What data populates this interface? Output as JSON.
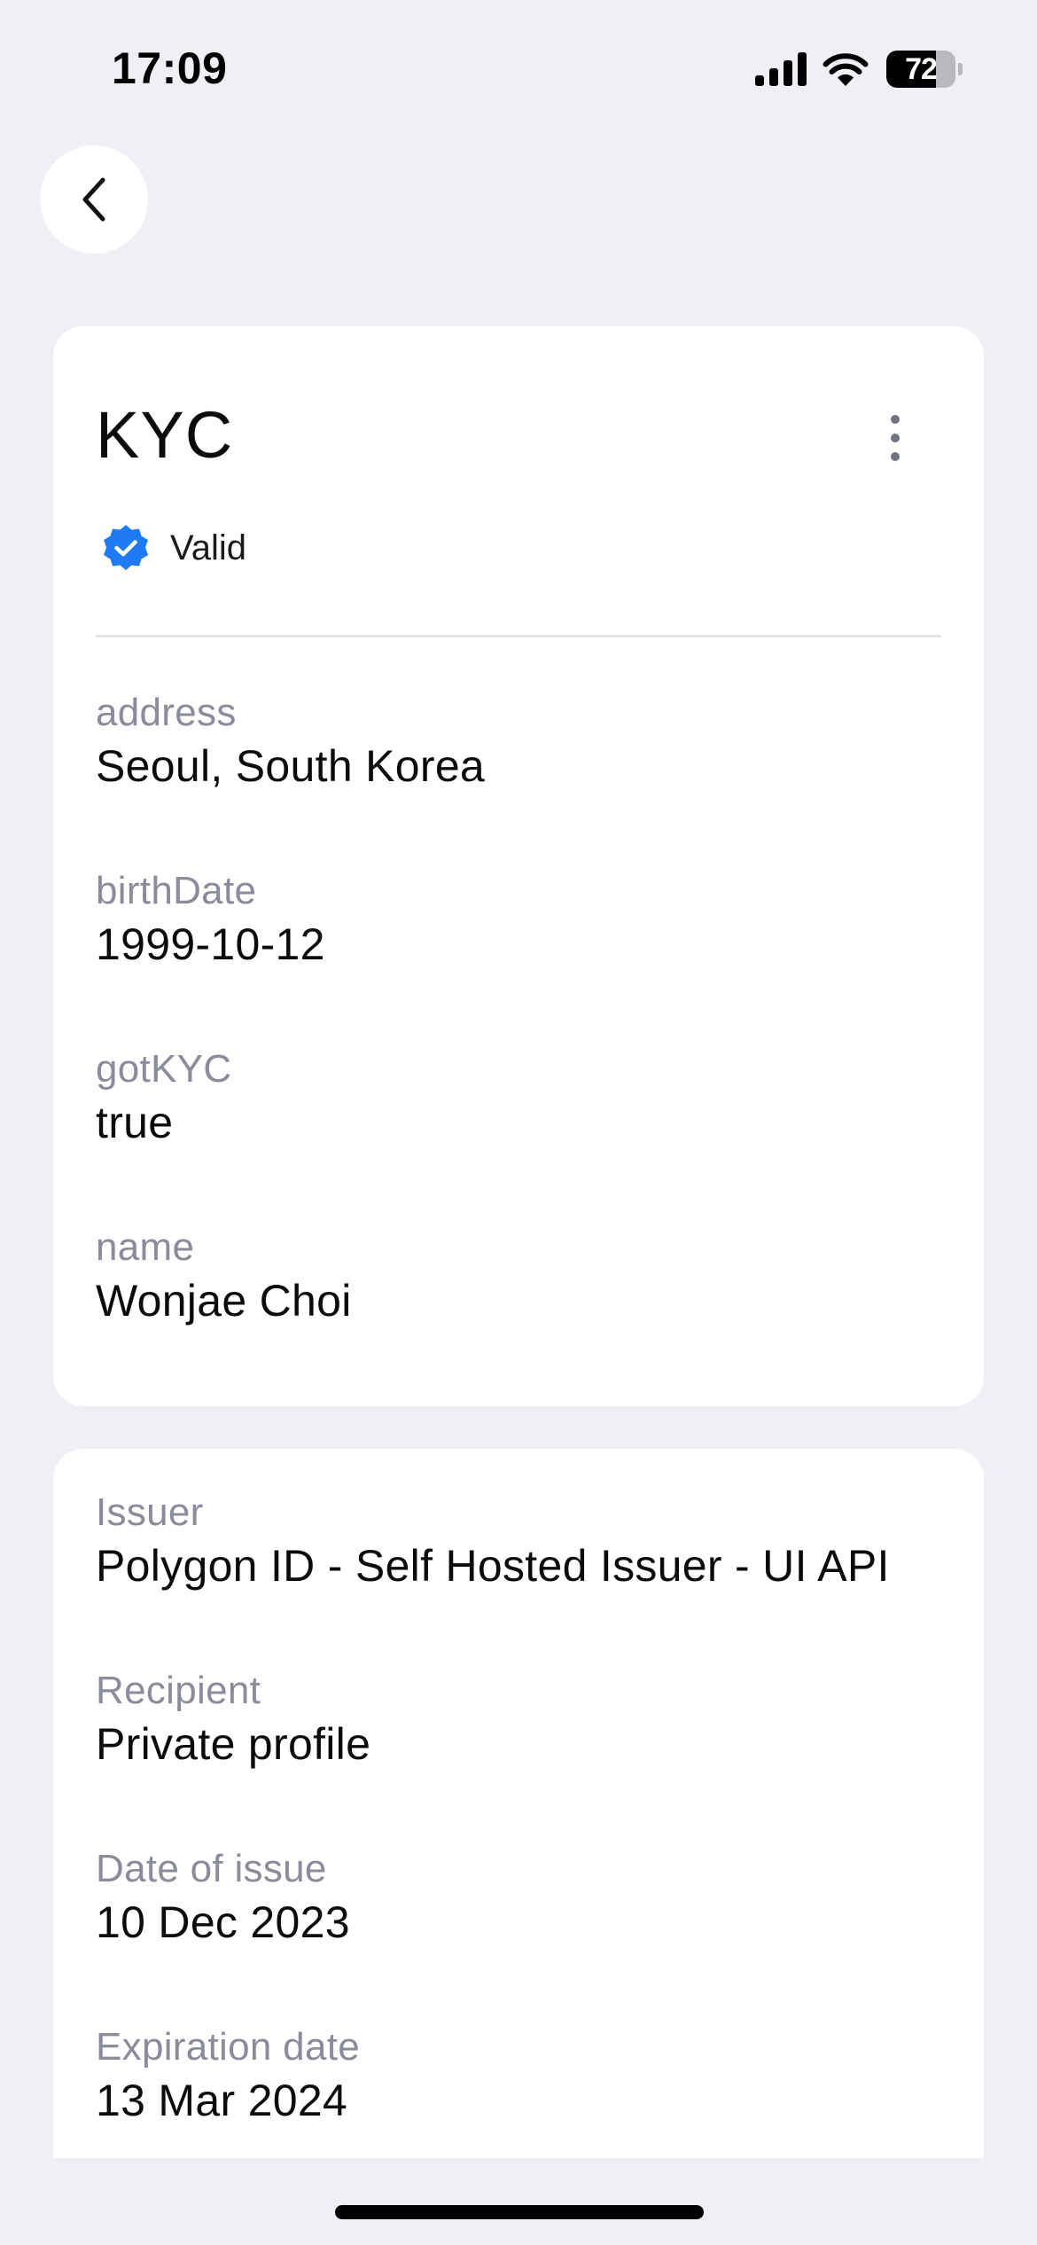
{
  "status_bar": {
    "time": "17:09",
    "battery_percent": 72,
    "battery_label": "72",
    "icons": [
      "cellular-signal-icon",
      "wifi-icon",
      "battery-icon"
    ]
  },
  "nav": {
    "back_icon": "chevron-left-icon"
  },
  "credential": {
    "title": "KYC",
    "more_icon": "vertical-ellipsis-icon",
    "status": {
      "label": "Valid",
      "icon": "verified-badge-icon",
      "color": "#1e7bf5"
    },
    "attributes": [
      {
        "label": "address",
        "value": "Seoul, South Korea"
      },
      {
        "label": "birthDate",
        "value": "1999-10-12"
      },
      {
        "label": "gotKYC",
        "value": "true"
      },
      {
        "label": "name",
        "value": "Wonjae Choi"
      }
    ]
  },
  "metadata": [
    {
      "label": "Issuer",
      "value": "Polygon ID - Self Hosted Issuer - UI API"
    },
    {
      "label": "Recipient",
      "value": "Private profile"
    },
    {
      "label": "Date of issue",
      "value": "10 Dec 2023"
    },
    {
      "label": "Expiration date",
      "value": "13 Mar 2024"
    }
  ],
  "colors": {
    "background": "#eff0f5",
    "card": "#ffffff",
    "label": "#8a8c9c",
    "text": "#0b0b0b",
    "accent": "#1e7bf5"
  }
}
